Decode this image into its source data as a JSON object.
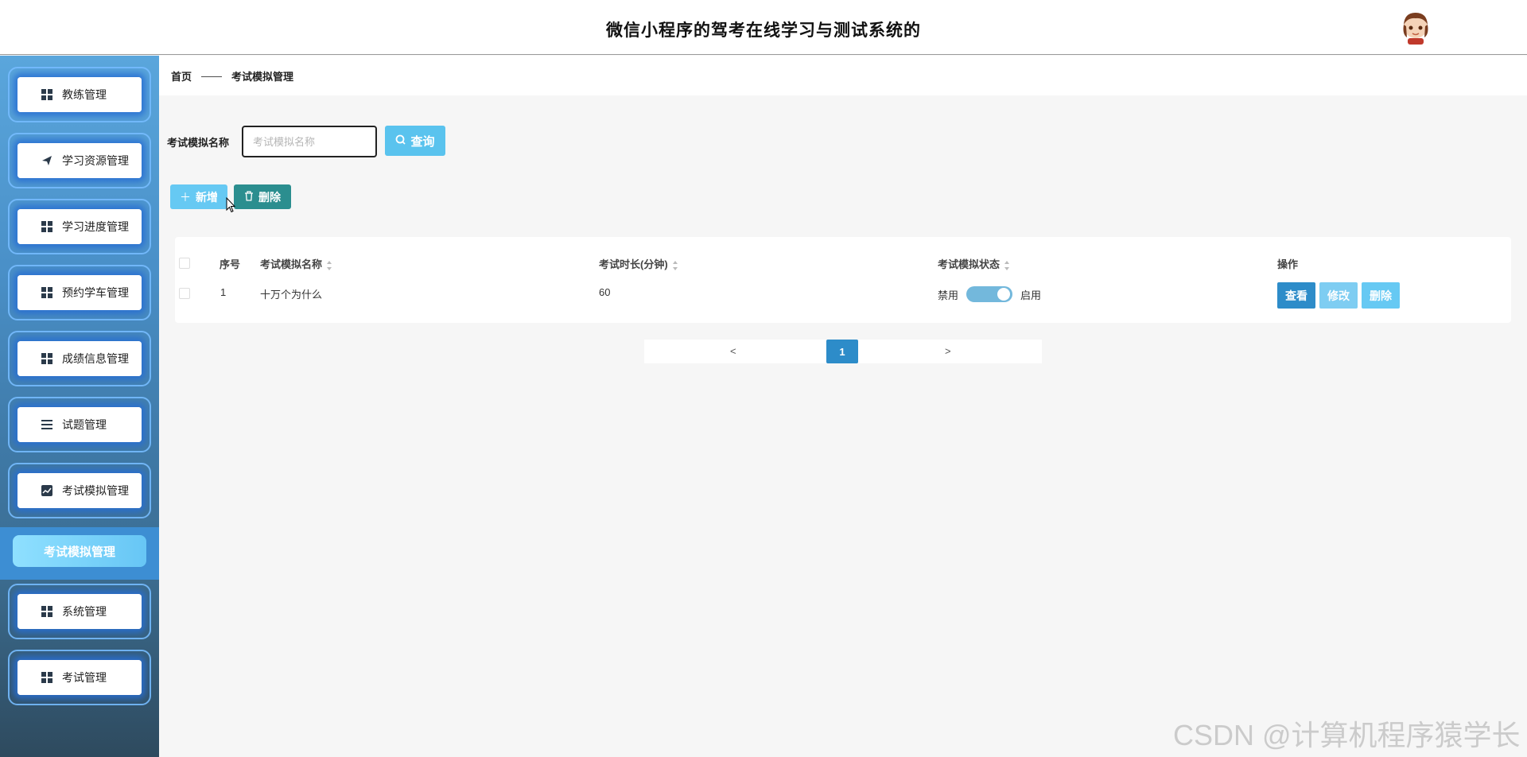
{
  "header": {
    "title": "微信小程序的驾考在线学习与测试系统的"
  },
  "sidebar": {
    "items": [
      {
        "label": "教练管理",
        "icon": "grid-icon"
      },
      {
        "label": "学习资源管理",
        "icon": "paper-plane-icon"
      },
      {
        "label": "学习进度管理",
        "icon": "grid-icon"
      },
      {
        "label": "预约学车管理",
        "icon": "grid-icon"
      },
      {
        "label": "成绩信息管理",
        "icon": "grid-icon"
      },
      {
        "label": "试题管理",
        "icon": "list-icon"
      },
      {
        "label": "考试模拟管理",
        "icon": "chart-icon"
      },
      {
        "label": "系统管理",
        "icon": "grid-icon"
      },
      {
        "label": "考试管理",
        "icon": "grid-icon"
      }
    ],
    "active_sub": "考试模拟管理"
  },
  "breadcrumb": {
    "home": "首页",
    "sep": "——",
    "current": "考试模拟管理"
  },
  "search": {
    "label": "考试模拟名称",
    "placeholder": "考试模拟名称",
    "button": "查询"
  },
  "actions": {
    "add": "新增",
    "delete": "删除"
  },
  "table": {
    "columns": [
      "序号",
      "考试模拟名称",
      "考试时长(分钟)",
      "考试模拟状态",
      "操作"
    ],
    "rows": [
      {
        "index": "1",
        "name": "十万个为什么",
        "duration": "60",
        "status_off": "禁用",
        "status_on": "启用",
        "enabled": true
      }
    ],
    "row_actions": {
      "view": "查看",
      "edit": "修改",
      "delete": "删除"
    }
  },
  "pagination": {
    "prev": "<",
    "current": "1",
    "next": ">"
  },
  "watermark": "CSDN @计算机程序猿学长",
  "colors": {
    "primary": "#2d8cc9",
    "light_blue": "#66c9f3",
    "teal": "#2b8e8f"
  }
}
